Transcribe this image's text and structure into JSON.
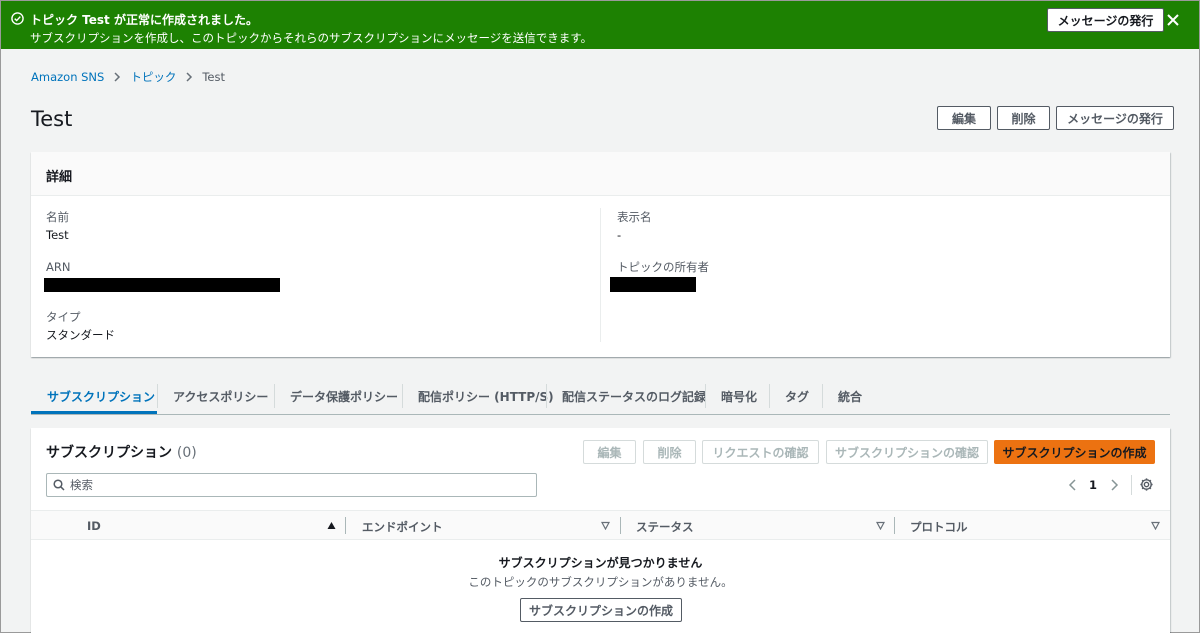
{
  "flash": {
    "title": "トピック Test が正常に作成されました。",
    "message": "サブスクリプションを作成し、このトピックからそれらのサブスクリプションにメッセージを送信できます。",
    "action_label": "メッセージの発行",
    "color": "#1d8102"
  },
  "breadcrumb": [
    "Amazon SNS",
    "トピック",
    "Test"
  ],
  "page": {
    "title": "Test",
    "actions": {
      "edit": "編集",
      "delete": "削除",
      "publish": "メッセージの発行"
    }
  },
  "details": {
    "header": "詳細",
    "name_label": "名前",
    "name_value": "Test",
    "arn_label": "ARN",
    "type_label": "タイプ",
    "type_value": "スタンダード",
    "display_name_label": "表示名",
    "display_name_value": "-",
    "owner_label": "トピックの所有者"
  },
  "tabs": [
    "サブスクリプション",
    "アクセスポリシー",
    "データ保護ポリシー",
    "配信ポリシー (HTTP/S)",
    "配信ステータスのログ記録",
    "暗号化",
    "タグ",
    "統合"
  ],
  "subscriptions": {
    "title": "サブスクリプション",
    "count": "(0)",
    "actions": {
      "edit": "編集",
      "delete": "削除",
      "request_confirm": "リクエストの確認",
      "confirm": "サブスクリプションの確認",
      "create": "サブスクリプションの作成"
    },
    "search_placeholder": "検索",
    "page_number": "1",
    "columns": [
      "ID",
      "エンドポイント",
      "ステータス",
      "プロトコル"
    ],
    "empty_title": "サブスクリプションが見つかりません",
    "empty_message": "このトピックのサブスクリプションがありません。",
    "empty_action": "サブスクリプションの作成"
  },
  "colors": {
    "accent": "#0073bb",
    "primary_button": "#ec7211"
  }
}
